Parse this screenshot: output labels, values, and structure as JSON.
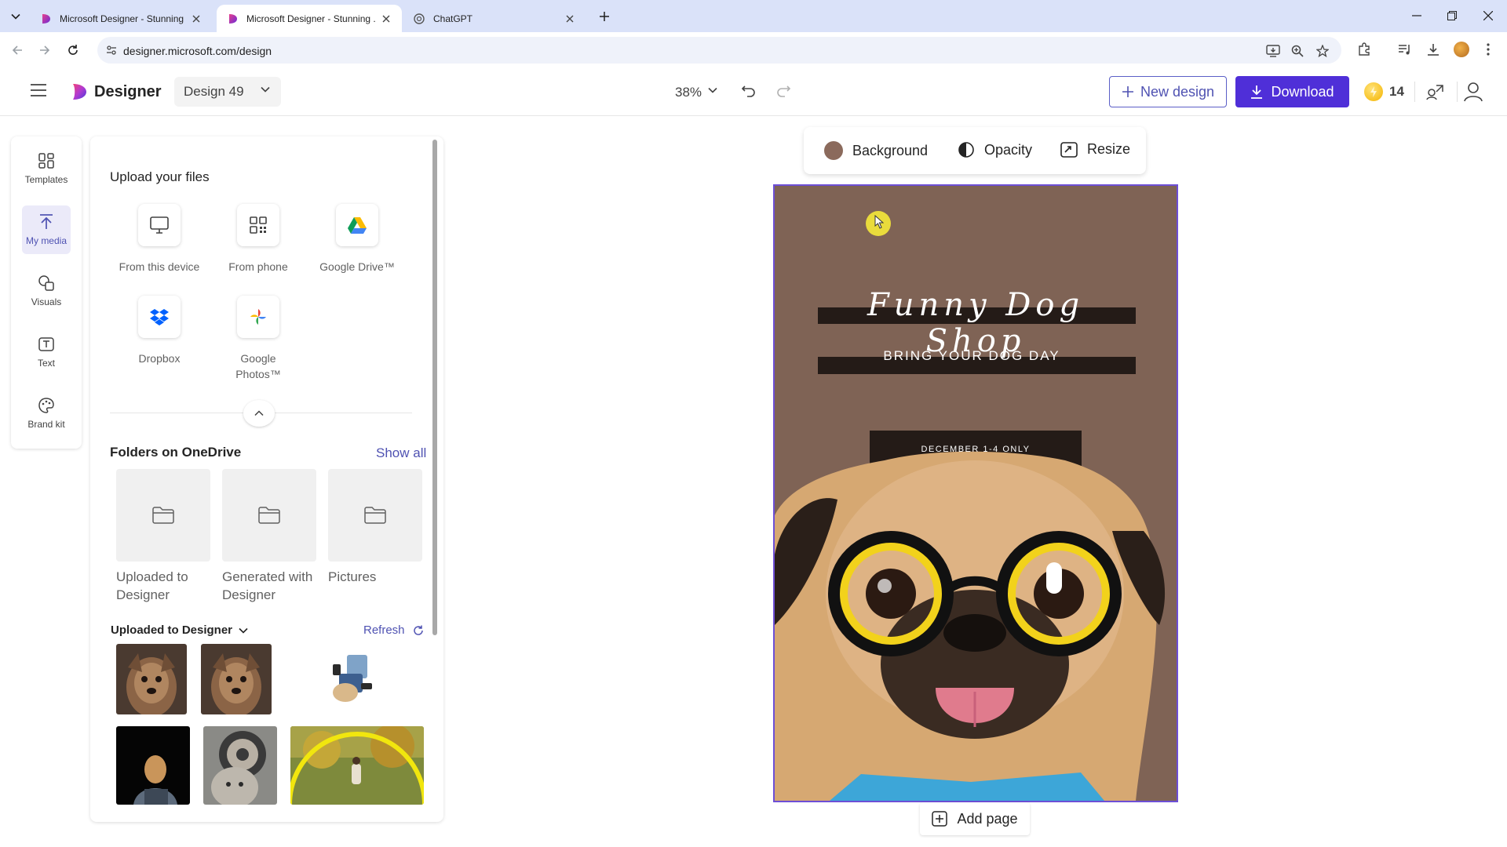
{
  "browser": {
    "tabs": [
      {
        "title": "Microsoft Designer - Stunning ...",
        "active": false
      },
      {
        "title": "Microsoft Designer - Stunning ...",
        "active": true
      },
      {
        "title": "ChatGPT",
        "active": false
      }
    ],
    "url": "designer.microsoft.com/design"
  },
  "header": {
    "brand": "Designer",
    "design_name": "Design 49",
    "zoom": "38%",
    "new_design_label": "New design",
    "download_label": "Download",
    "credits": "14"
  },
  "rail": {
    "items": [
      {
        "label": "Templates",
        "icon": "templates-icon"
      },
      {
        "label": "My media",
        "icon": "upload-arrow-icon",
        "active": true
      },
      {
        "label": "Visuals",
        "icon": "shapes-icon"
      },
      {
        "label": "Text",
        "icon": "text-box-icon"
      },
      {
        "label": "Brand kit",
        "icon": "palette-icon"
      }
    ]
  },
  "media_panel": {
    "upload_title": "Upload your files",
    "sources": [
      {
        "label": "From this device",
        "icon": "monitor-icon"
      },
      {
        "label": "From phone",
        "icon": "qr-code-icon"
      },
      {
        "label": "Google Drive™",
        "icon": "google-drive-icon"
      },
      {
        "label": "Dropbox",
        "icon": "dropbox-icon"
      },
      {
        "label": "Google Photos™",
        "icon": "google-photos-icon"
      }
    ],
    "folders_title": "Folders on OneDrive",
    "show_all": "Show all",
    "folders": [
      {
        "label": "Uploaded to Designer"
      },
      {
        "label": "Generated with Designer"
      },
      {
        "label": "Pictures"
      }
    ],
    "uploaded_title": "Uploaded to Designer",
    "refresh_label": "Refresh"
  },
  "context_bar": {
    "background_label": "Background",
    "opacity_label": "Opacity",
    "resize_label": "Resize"
  },
  "canvas": {
    "headline": "Funny Dog Shop",
    "subline": "BRING YOUR DOG DAY",
    "dates": "DECEMBER 1-4 ONLY",
    "add_page_label": "Add page"
  },
  "colors": {
    "accent": "#4f2fd8",
    "link": "#4f52b2",
    "artboard_bg": "#7f6355",
    "selection": "#6d4fd6"
  }
}
